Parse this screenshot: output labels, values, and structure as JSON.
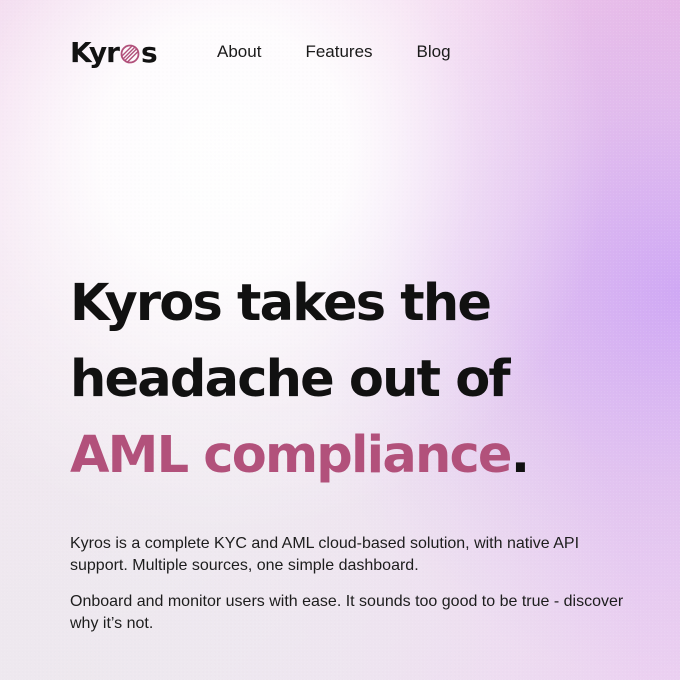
{
  "brand": {
    "name_left": "Ky",
    "name_middle": "r",
    "name_right": "s",
    "logo_icon": "striped-o-icon",
    "accent_color": "#b2517b"
  },
  "nav": {
    "items": [
      {
        "label": "About"
      },
      {
        "label": "Features"
      },
      {
        "label": "Blog"
      }
    ]
  },
  "hero": {
    "line_1": "Kyros takes the",
    "line_2": "headache out of",
    "accent": "AML compliance",
    "period": "."
  },
  "body": {
    "paragraph_1": "Kyros is a complete KYC and AML cloud-based solution, with native API support. Multiple sources, one simple dashboard.",
    "paragraph_2": "Onboard and monitor users with ease. It sounds too good to be true - discover why it’s not."
  }
}
